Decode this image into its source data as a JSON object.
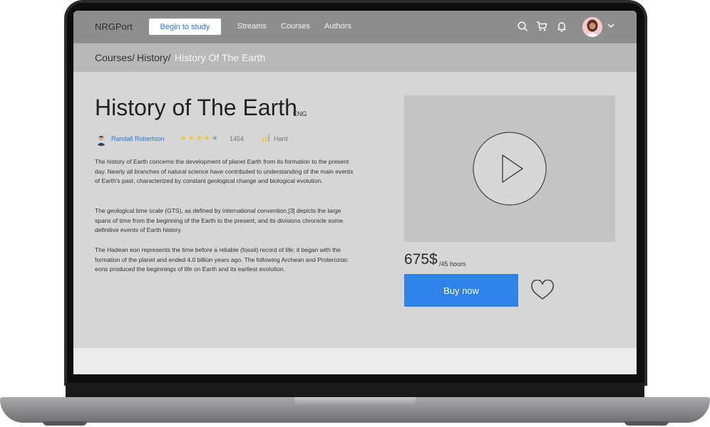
{
  "navbar": {
    "logo": "NRGPort",
    "begin_button": "Begin to study",
    "links": [
      "Streams",
      "Courses",
      "Authors"
    ],
    "icons": [
      "search-icon",
      "cart-icon",
      "bell-icon",
      "chevron-down-icon"
    ]
  },
  "breadcrumb": {
    "items": [
      "Courses/",
      "History/"
    ],
    "current": "History Of The Earth"
  },
  "course": {
    "title": "History of The Earth",
    "language": "ENG",
    "author": "Randall Robertson",
    "rating_stars": 4,
    "rating_max": 5,
    "rating_count": "1454",
    "level": "Hard",
    "paragraphs": [
      "The history of Earth concerns the development of planet Earth from its formation to the present day. Nearly all branches of natural science have contributed to understanding of the main events of Earth's past, characterized by constant geological change and biological evolution.",
      "The geological time scale (GTS), as defined by international convention,[3] depicts the large spans of time from the beginning of the Earth to the present, and its divisions chronicle some definitive events of Earth history.",
      "The Hadean eon represents the time before a reliable (fossil) record of life; it began with the formation of the planet and ended 4.0 billion years ago. The following Archean and Proterozoic eons produced the beginnings of life on Earth and its earliest evolution."
    ]
  },
  "purchase": {
    "price": "675$",
    "per": "/45 hours",
    "buy_button": "Buy now"
  },
  "colors": {
    "accent": "#2e82e8",
    "navbar": "#8e8e8e",
    "breadcrumb_bar": "#b8b8b8",
    "main_bg": "#d6d6d6",
    "star": "#f1c232"
  }
}
